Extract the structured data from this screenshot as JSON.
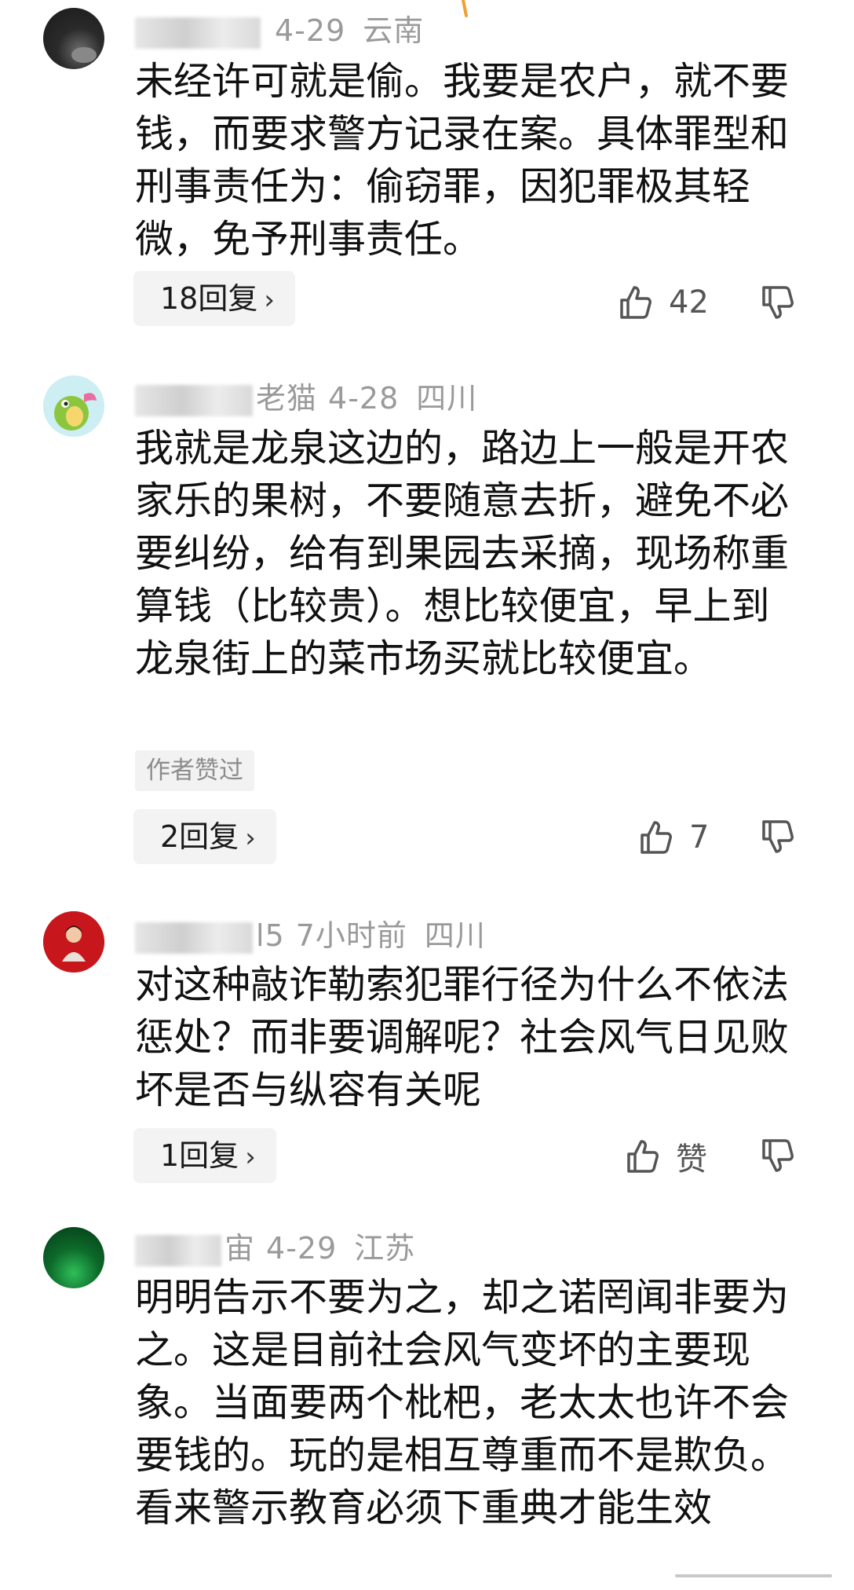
{
  "comments": [
    {
      "name_visible": "",
      "date": "4-29",
      "region": "云南",
      "text": "未经许可就是偷。我要是农户，就不要钱，而要求警方记录在案。具体罪型和刑事责任为：偷窃罪，因犯罪极其轻微，免予刑事责任。",
      "replies": "18回复",
      "likes": "42"
    },
    {
      "name_visible": "老猫",
      "date": "4-28",
      "region": "四川",
      "text": "我就是龙泉这边的，路边上一般是开农家乐的果树，不要随意去折，避免不必要纠纷，给有到果园去采摘，现场称重算钱（比较贵）。想比较便宜，早上到龙泉街上的菜市场买就比较便宜。",
      "badge": "作者赞过",
      "replies": "2回复",
      "likes": "7"
    },
    {
      "name_visible": "l5",
      "date": "7小时前",
      "region": "四川",
      "text": "对这种敲诈勒索犯罪行径为什么不依法惩处？而非要调解呢？社会风气日见败坏是否与纵容有关呢",
      "replies": "1回复",
      "likes": "赞"
    },
    {
      "name_visible": "宙",
      "date": "4-29",
      "region": "江苏",
      "text": "明明告示不要为之，却之诺罔闻非要为之。这是目前社会风气变坏的主要现象。当面要两个枇杷，老太太也许不会要钱的。玩的是相互尊重而不是欺负。看来警示教育必须下重典才能生效"
    }
  ],
  "icons": {
    "like": "thumbs-up-icon",
    "dislike": "thumbs-down-icon",
    "chevron": "chevron-right-icon"
  },
  "chevron_char": "›",
  "colors": {
    "meta": "#9a9a9a",
    "text": "#111111",
    "button_bg": "#f3f3f3",
    "accent_mark": "#f0a030"
  }
}
